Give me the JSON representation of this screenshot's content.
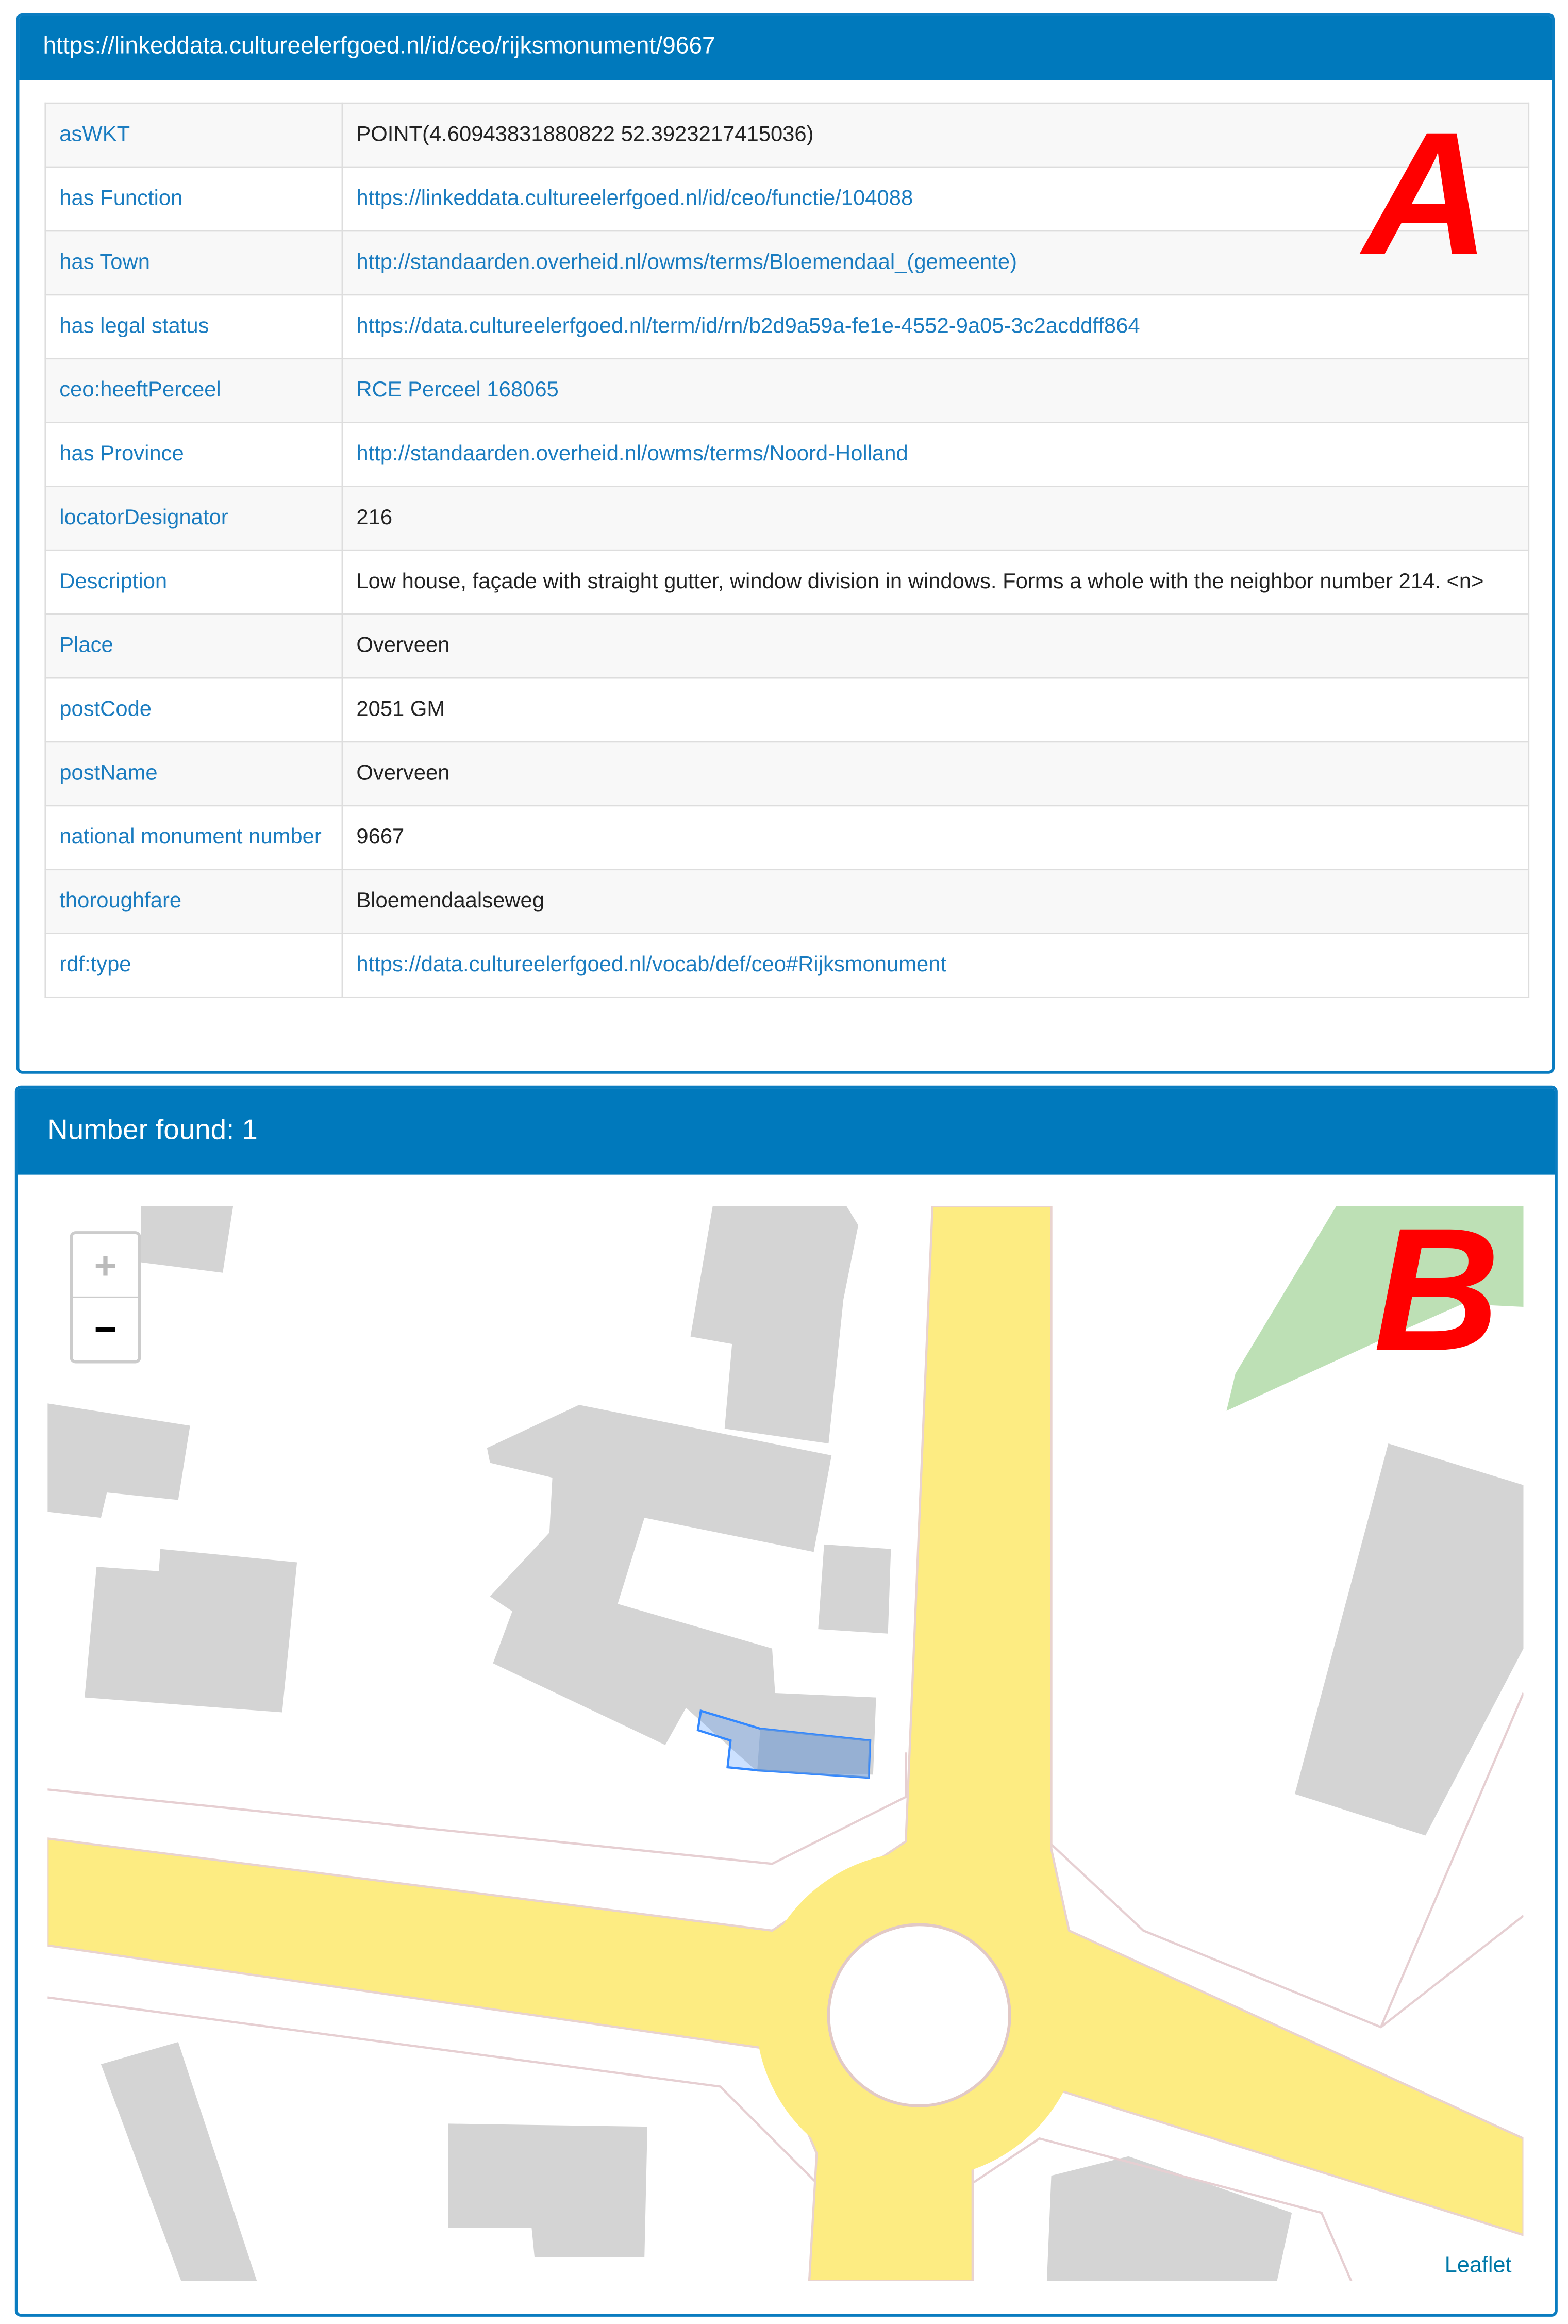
{
  "panel_a": {
    "title": "https://linkeddata.cultureelerfgoed.nl/id/ceo/rijksmonument/9667",
    "rows": [
      {
        "key": "asWKT",
        "value": "POINT(4.60943831880822 52.3923217415036)",
        "link": false
      },
      {
        "key": "has Function",
        "value": "https://linkeddata.cultureelerfgoed.nl/id/ceo/functie/104088",
        "link": true
      },
      {
        "key": "has Town",
        "value": "http://standaarden.overheid.nl/owms/terms/Bloemendaal_(gemeente)",
        "link": true
      },
      {
        "key": "has legal status",
        "value": "https://data.cultureelerfgoed.nl/term/id/rn/b2d9a59a-fe1e-4552-9a05-3c2acddff864",
        "link": true
      },
      {
        "key": "ceo:heeftPerceel",
        "value": "RCE Perceel 168065",
        "link": true
      },
      {
        "key": "has Province",
        "value": "http://standaarden.overheid.nl/owms/terms/Noord-Holland",
        "link": true
      },
      {
        "key": "locatorDesignator",
        "value": "216",
        "link": false
      },
      {
        "key": "Description",
        "value": "Low house, façade with straight gutter, window division in windows. Forms a whole with the neighbor number 214. <n>",
        "link": false
      },
      {
        "key": "Place",
        "value": "Overveen",
        "link": false
      },
      {
        "key": "postCode",
        "value": "2051 GM",
        "link": false
      },
      {
        "key": "postName",
        "value": "Overveen",
        "link": false
      },
      {
        "key": "national monument number",
        "value": "9667",
        "link": false
      },
      {
        "key": "thoroughfare",
        "value": "Bloemendaalseweg",
        "link": false
      },
      {
        "key": "rdf:type",
        "value": "https://data.cultureelerfgoed.nl/vocab/def/ceo#Rijksmonument",
        "link": true
      }
    ]
  },
  "panel_b": {
    "title": "Number found: 1",
    "zoom_in": "+",
    "zoom_out": "−",
    "attribution": "Leaflet"
  },
  "annotations": {
    "a": "A",
    "b": "B"
  },
  "colors": {
    "header": "#0079bc",
    "link": "#1a7cc0",
    "road": "#fdec82",
    "building": "#d4d4d4",
    "park": "#bde0b5",
    "selection": "#3388ff"
  }
}
